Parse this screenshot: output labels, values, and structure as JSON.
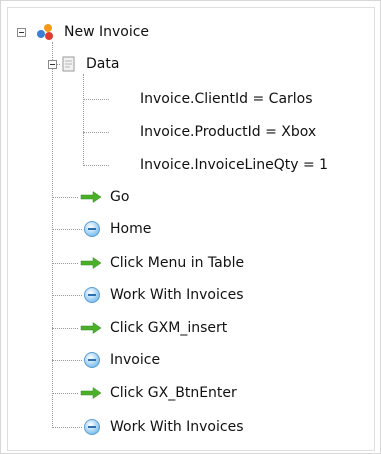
{
  "tree": {
    "root": {
      "label": "New Invoice",
      "icon": "people-icon",
      "expanded": true
    },
    "data_node": {
      "label": "Data",
      "icon": "data-icon",
      "expanded": true
    },
    "data_items": [
      "Invoice.ClientId = Carlos",
      "Invoice.ProductId = Xbox",
      "Invoice.InvoiceLineQty = 1"
    ],
    "steps": [
      {
        "label": "Go",
        "icon": "green-arrow-icon"
      },
      {
        "label": "Home",
        "icon": "blue-circle-icon"
      },
      {
        "label": "Click Menu in Table",
        "icon": "green-arrow-icon"
      },
      {
        "label": "Work With Invoices",
        "icon": "blue-circle-icon"
      },
      {
        "label": "Click GXM_insert",
        "icon": "green-arrow-icon"
      },
      {
        "label": "Invoice",
        "icon": "blue-circle-icon"
      },
      {
        "label": "Click GX_BtnEnter",
        "icon": "green-arrow-icon"
      },
      {
        "label": "Work With Invoices",
        "icon": "blue-circle-icon"
      }
    ]
  },
  "colors": {
    "arrow_green": "#4caf2a",
    "circle_blue": "#5ea7dc",
    "tree_line": "#9a9a9a"
  }
}
